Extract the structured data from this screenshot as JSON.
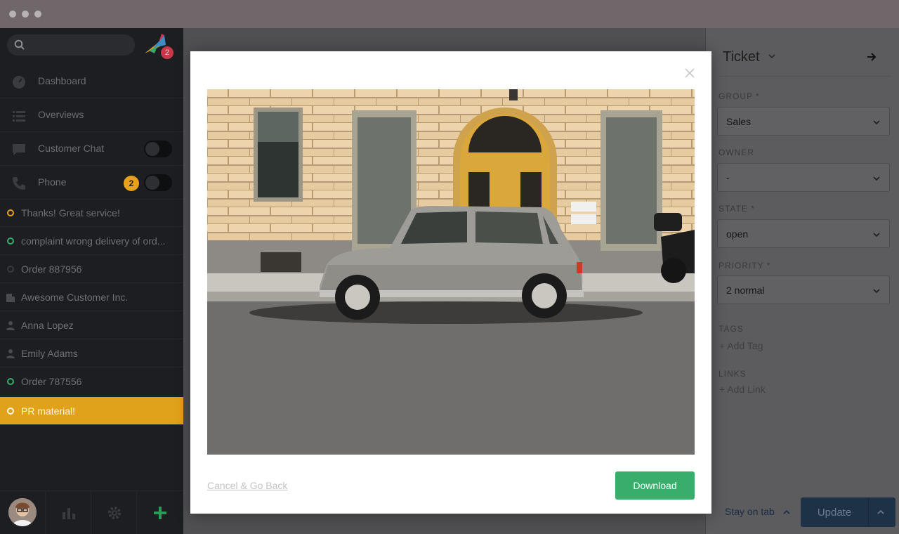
{
  "sidebar": {
    "nav": [
      {
        "label": "Dashboard",
        "icon": "dashboard-icon"
      },
      {
        "label": "Overviews",
        "icon": "list-icon"
      },
      {
        "label": "Customer Chat",
        "icon": "chat-icon"
      },
      {
        "label": "Phone",
        "icon": "phone-icon",
        "badge": "2"
      }
    ],
    "logo_badge": "2",
    "tasks": [
      {
        "label": "Thanks! Great service!",
        "status": "open",
        "color": "#e8a11d"
      },
      {
        "label": "complaint wrong delivery of ord...",
        "status": "open",
        "color": "#38ae6a"
      },
      {
        "label": "Order 887956",
        "status": "closed",
        "color": "#555555"
      },
      {
        "label": "Awesome Customer Inc.",
        "status": "organization"
      },
      {
        "label": "Anna Lopez",
        "status": "user"
      },
      {
        "label": "Emily Adams",
        "status": "user"
      },
      {
        "label": "Order 787556",
        "status": "open",
        "color": "#38ae6a"
      },
      {
        "label": "PR material!",
        "status": "active",
        "color": "#ffffff"
      }
    ]
  },
  "modal": {
    "cancel_label": "Cancel & Go Back",
    "download_label": "Download"
  },
  "panel": {
    "title": "Ticket",
    "group_label": "GROUP *",
    "group_value": "Sales",
    "owner_label": "OWNER",
    "owner_value": "-",
    "state_label": "STATE *",
    "state_value": "open",
    "priority_label": "PRIORITY *",
    "priority_value": "2 normal",
    "tags_label": "TAGS",
    "add_tag": "+ Add Tag",
    "links_label": "LINKS",
    "add_link": "+ Add Link",
    "stay_on_tab": "Stay on tab",
    "update_label": "Update"
  },
  "colors": {
    "accent_orange": "#e0a21a",
    "download_green": "#38ae6a",
    "update_blue": "#1d3247"
  }
}
